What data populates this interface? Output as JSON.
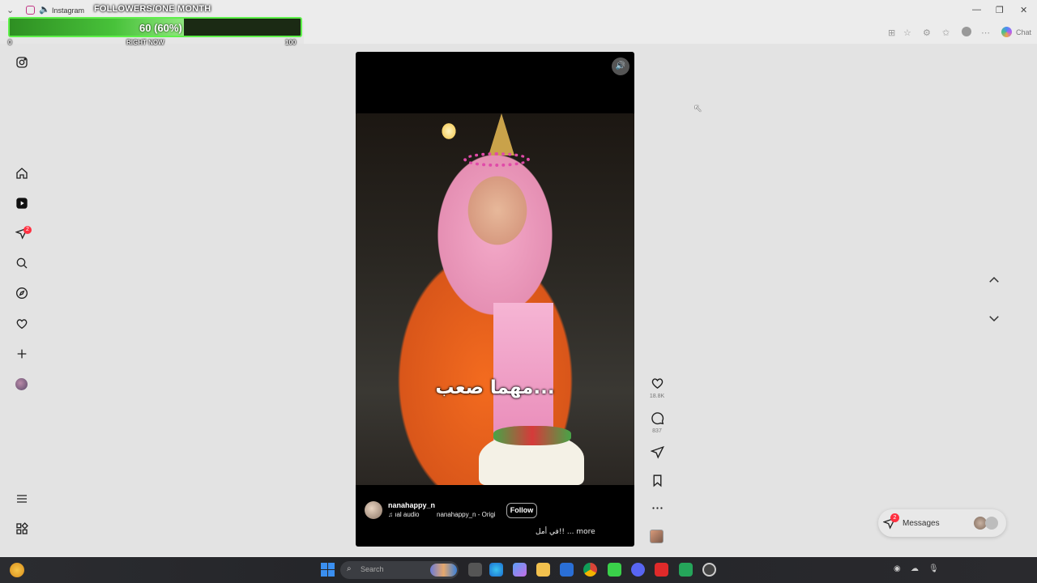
{
  "window": {
    "tab_title": "Instagram"
  },
  "overlay": {
    "title": "FOLLOWERS/ONE MONTH",
    "value_label": "60 (60%)",
    "progress_fraction": 0.6,
    "min_label": "0",
    "mid_label": "RIGHT NOW",
    "max_label": "100",
    "bar_color": "#5ef04a"
  },
  "browser": {
    "chat_label": "Chat"
  },
  "sidebar": {
    "notification_count": "2",
    "items": [
      "instagram-logo",
      "home",
      "reels",
      "notifications",
      "search",
      "explore",
      "notifications-heart",
      "create",
      "profile",
      "more",
      "also-from-meta"
    ]
  },
  "reel": {
    "caption": "مهما صعب...",
    "username": "nanahappy_n",
    "audio_label": "♫ ıal audio",
    "audio_sub": "nanahappy_n - Origi",
    "follow_label": "Follow",
    "description": "في أمل!! ... more",
    "mute_icon": "speaker-icon"
  },
  "actions": {
    "likes": "18.8K",
    "comments": "837"
  },
  "messages": {
    "label": "Messages",
    "badge": "2"
  },
  "taskbar": {
    "search_placeholder": "Search"
  },
  "colors": {
    "accent": "#ff3040",
    "progress": "#48c23a"
  }
}
